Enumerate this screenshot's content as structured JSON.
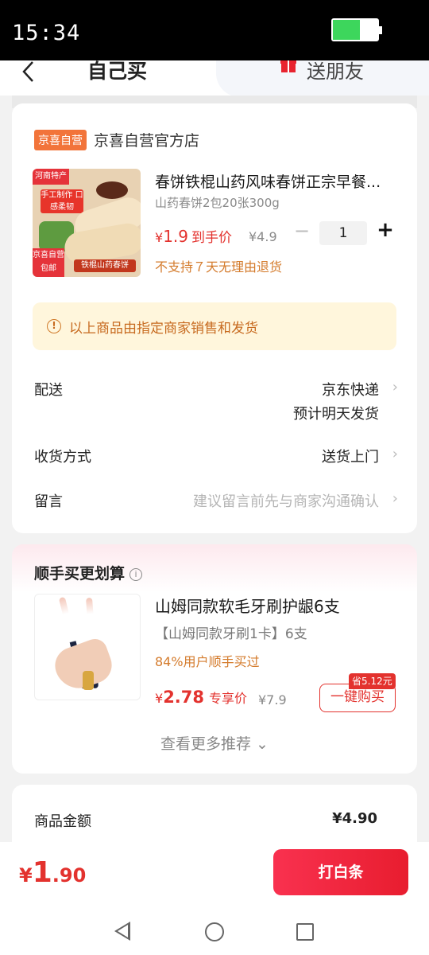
{
  "status_bar": {
    "time": "15:34"
  },
  "header": {
    "back_icon": "chevron-left-icon",
    "tab_self": "自己买",
    "tab_friend": "送朋友",
    "gift_icon": "gift-icon"
  },
  "store": {
    "tag": "京喜自营",
    "name": "京喜自营官方店"
  },
  "product": {
    "image_badge_top": "河南特产",
    "image_title": "手工制作 口感柔韧",
    "image_badge_bottom": "京喜自营 包邮",
    "image_label": "铁棍山药春饼",
    "title": "春饼铁棍山药风味春饼正宗早餐...",
    "spec": "山药春饼2包20张300g",
    "price_symbol": "¥",
    "price": "1.9",
    "price_label": "到手价",
    "original_price": "¥4.9",
    "quantity": "1",
    "minus": "−",
    "plus": "+",
    "no_return": "不支持７天无理由退货"
  },
  "notice": {
    "icon": "info-icon",
    "text": "以上商品由指定商家销售和发货"
  },
  "delivery": {
    "label": "配送",
    "value": "京东快递",
    "sub": "预计明天发货"
  },
  "receive": {
    "label": "收货方式",
    "value": "送货上门"
  },
  "message": {
    "label": "留言",
    "placeholder": "建议留言前先与商家沟通确认"
  },
  "chevron": "›",
  "recommend": {
    "title": "顺手买更划算",
    "info_icon": "i",
    "name": "山姆同款软毛牙刷护龈6支",
    "spec": "【山姆同款牙刷1卡】6支",
    "percent": "84%用户顺手买过",
    "price_symbol": "¥",
    "price": "2.78",
    "price_label": "专享价",
    "original_price": "¥7.9",
    "save_badge": "省5.12元",
    "buy_button": "一键购买",
    "more": "查看更多推荐 ⌄"
  },
  "summary": {
    "label": "商品金额",
    "value": "¥4.90"
  },
  "bottom": {
    "total_symbol": "¥",
    "total_int": "1",
    "total_dec": ".90",
    "pay_button": "打白条"
  }
}
